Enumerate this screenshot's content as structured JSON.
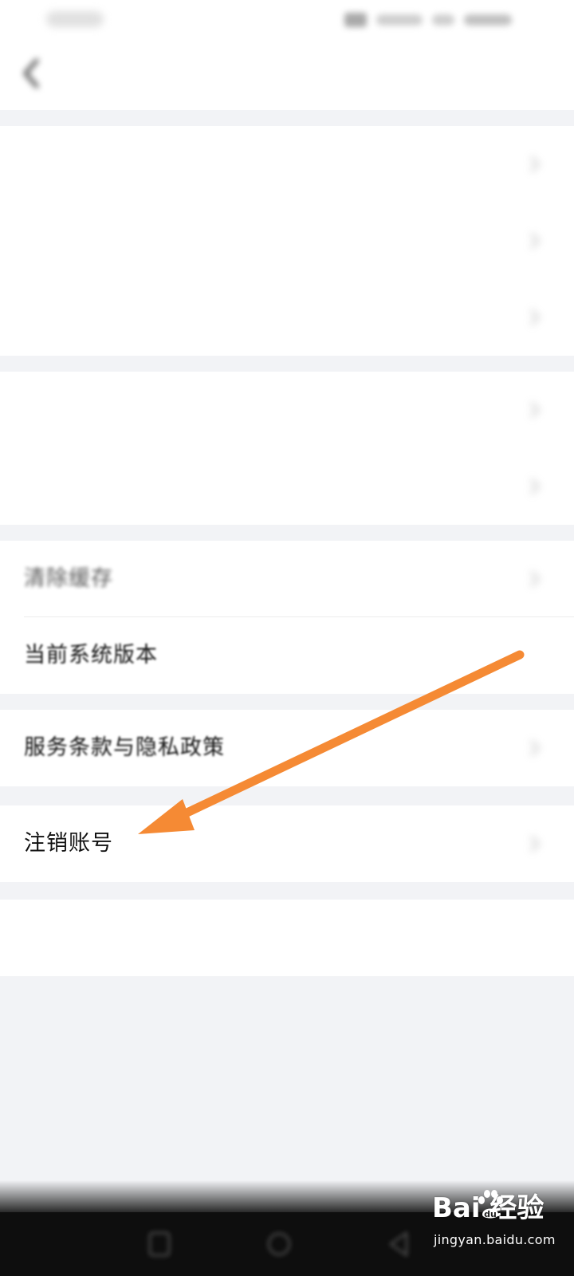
{
  "header": {
    "title": ""
  },
  "groups": [
    {
      "rows": [
        {
          "label": "",
          "value": ""
        },
        {
          "label": "",
          "value": ""
        },
        {
          "label": "",
          "value": ""
        }
      ]
    },
    {
      "rows": [
        {
          "label": "",
          "value": ""
        },
        {
          "label": "",
          "value": ""
        }
      ]
    },
    {
      "rows": [
        {
          "label": "清除缓存",
          "value": ""
        },
        {
          "label": "当前系统版本",
          "value": ""
        }
      ]
    },
    {
      "rows": [
        {
          "label": "服务条款与隐私政策",
          "value": ""
        }
      ]
    },
    {
      "rows": [
        {
          "label": "注销账号",
          "value": ""
        }
      ]
    }
  ],
  "logout": {
    "label": ""
  },
  "annotation": {
    "color": "#f58a34"
  },
  "watermark": {
    "brand": "Bai  经验",
    "url": "jingyan.baidu.com"
  },
  "colors": {
    "background": "#f2f3f6",
    "accent": "#2f7be6",
    "arrow": "#f58a34"
  }
}
